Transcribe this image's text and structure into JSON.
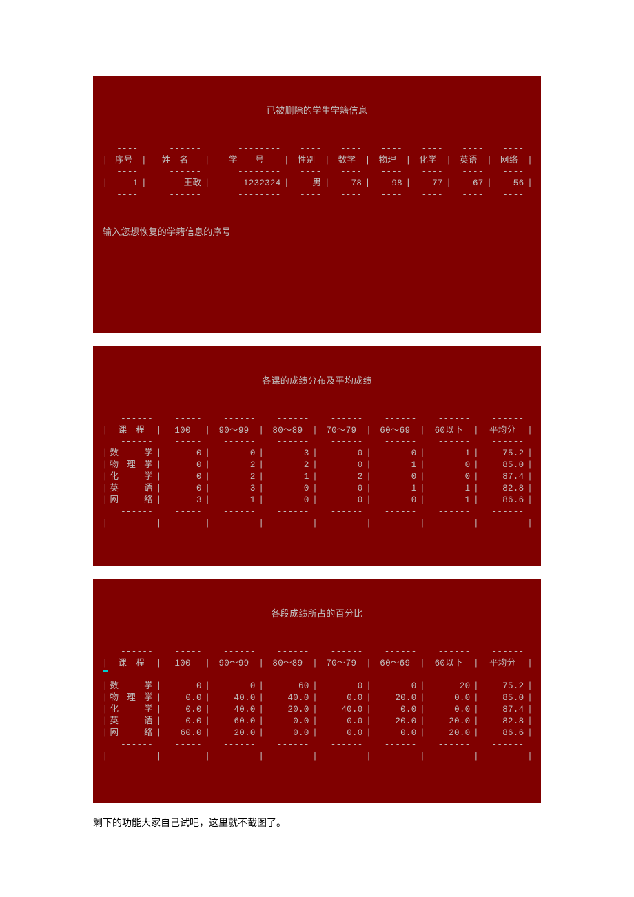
{
  "console1": {
    "title": "已被删除的学生学籍信息",
    "headers": [
      "序号",
      "姓　名",
      "学　　号",
      "性别",
      "数学",
      "物理",
      "化学",
      "英语",
      "网络"
    ],
    "rows": [
      {
        "seq": "1",
        "name": "王政",
        "id": "1232324",
        "gender": "男",
        "math": "78",
        "physics": "98",
        "chem": "77",
        "eng": "67",
        "net": "56"
      }
    ],
    "prompt": "输入您想恢复的学籍信息的序号"
  },
  "console2": {
    "title": "各课的成绩分布及平均成绩",
    "headers": [
      "课　程",
      "100",
      "90～99",
      "80～89",
      "70～79",
      "60～69",
      "60以下",
      "平均分"
    ],
    "rows": [
      {
        "subject": "数　学",
        "c100": "0",
        "c90": "0",
        "c80": "3",
        "c70": "0",
        "c60": "0",
        "clt": "1",
        "avg": "75.2"
      },
      {
        "subject": "物理学",
        "c100": "0",
        "c90": "2",
        "c80": "2",
        "c70": "0",
        "c60": "1",
        "clt": "0",
        "avg": "85.0"
      },
      {
        "subject": "化　学",
        "c100": "0",
        "c90": "2",
        "c80": "1",
        "c70": "2",
        "c60": "0",
        "clt": "0",
        "avg": "87.4"
      },
      {
        "subject": "英　语",
        "c100": "0",
        "c90": "3",
        "c80": "0",
        "c70": "0",
        "c60": "1",
        "clt": "1",
        "avg": "82.8"
      },
      {
        "subject": "网　络",
        "c100": "3",
        "c90": "1",
        "c80": "0",
        "c70": "0",
        "c60": "0",
        "clt": "1",
        "avg": "86.6"
      }
    ]
  },
  "console3": {
    "title": "各段成绩所占的百分比",
    "headers": [
      "课　程",
      "100",
      "90～99",
      "80～89",
      "70～79",
      "60～69",
      "60以下",
      "平均分"
    ],
    "rows": [
      {
        "subject": "数　学",
        "c100": "0",
        "c90": "0",
        "c80": "60",
        "c70": "0",
        "c60": "0",
        "clt": "20",
        "avg": "75.2"
      },
      {
        "subject": "物理学",
        "c100": "0.0",
        "c90": "40.0",
        "c80": "40.0",
        "c70": "0.0",
        "c60": "20.0",
        "clt": "0.0",
        "avg": "85.0"
      },
      {
        "subject": "化　学",
        "c100": "0.0",
        "c90": "40.0",
        "c80": "20.0",
        "c70": "40.0",
        "c60": "0.0",
        "clt": "0.0",
        "avg": "87.4"
      },
      {
        "subject": "英　语",
        "c100": "0.0",
        "c90": "60.0",
        "c80": "0.0",
        "c70": "0.0",
        "c60": "20.0",
        "clt": "20.0",
        "avg": "82.8"
      },
      {
        "subject": "网　络",
        "c100": "60.0",
        "c90": "20.0",
        "c80": "0.0",
        "c70": "0.0",
        "c60": "0.0",
        "clt": "20.0",
        "avg": "86.6"
      }
    ]
  },
  "footer": "剩下的功能大家自己试吧，这里就不截图了。",
  "chart_data": [
    {
      "type": "table",
      "title": "各课的成绩分布及平均成绩",
      "categories": [
        "数学",
        "物理学",
        "化学",
        "英语",
        "网络"
      ],
      "columns": [
        "100",
        "90～99",
        "80～89",
        "70～79",
        "60～69",
        "60以下",
        "平均分"
      ],
      "series": [
        {
          "name": "数学",
          "values": [
            0,
            0,
            3,
            0,
            0,
            1,
            75.2
          ]
        },
        {
          "name": "物理学",
          "values": [
            0,
            2,
            2,
            0,
            1,
            0,
            85.0
          ]
        },
        {
          "name": "化学",
          "values": [
            0,
            2,
            1,
            2,
            0,
            0,
            87.4
          ]
        },
        {
          "name": "英语",
          "values": [
            0,
            3,
            0,
            0,
            1,
            1,
            82.8
          ]
        },
        {
          "name": "网络",
          "values": [
            3,
            1,
            0,
            0,
            0,
            1,
            86.6
          ]
        }
      ]
    },
    {
      "type": "table",
      "title": "各段成绩所占的百分比",
      "categories": [
        "数学",
        "物理学",
        "化学",
        "英语",
        "网络"
      ],
      "columns": [
        "100",
        "90～99",
        "80～89",
        "70～79",
        "60～69",
        "60以下",
        "平均分"
      ],
      "series": [
        {
          "name": "数学",
          "values": [
            0,
            0,
            60,
            0,
            0,
            20,
            75.2
          ]
        },
        {
          "name": "物理学",
          "values": [
            0.0,
            40.0,
            40.0,
            0.0,
            20.0,
            0.0,
            85.0
          ]
        },
        {
          "name": "化学",
          "values": [
            0.0,
            40.0,
            20.0,
            40.0,
            0.0,
            0.0,
            87.4
          ]
        },
        {
          "name": "英语",
          "values": [
            0.0,
            60.0,
            0.0,
            0.0,
            20.0,
            20.0,
            82.8
          ]
        },
        {
          "name": "网络",
          "values": [
            60.0,
            20.0,
            0.0,
            0.0,
            0.0,
            20.0,
            86.6
          ]
        }
      ]
    }
  ]
}
